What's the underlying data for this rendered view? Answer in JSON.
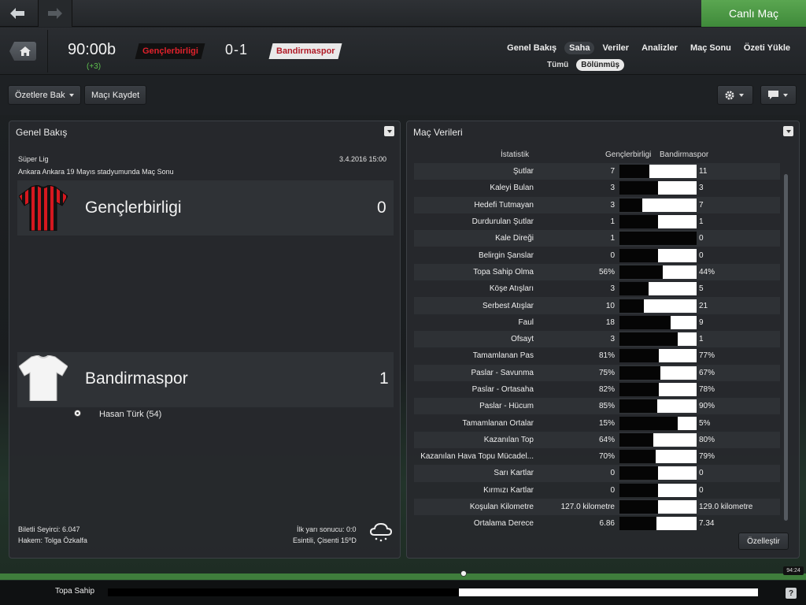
{
  "topbar": {
    "live_label": "Canlı Maç"
  },
  "match": {
    "clock": "90:00b",
    "added_time": "(+3)",
    "home_team": "Gençlerbirligi",
    "away_team": "Bandirmaspor",
    "score": "0-1"
  },
  "nav_tabs": [
    "Genel Bakış",
    "Saha",
    "Veriler",
    "Analizler",
    "Maç Sonu",
    "Özeti Yükle"
  ],
  "sub_tabs": [
    "Tümü",
    "Bölünmüş"
  ],
  "toolbar": {
    "highlights_label": "Özetlere Bak",
    "save_label": "Maçı Kaydet"
  },
  "overview": {
    "title": "Genel Bakış",
    "competition": "Süper Lig",
    "datetime": "3.4.2016 15:00",
    "venue": "Ankara Ankara 19 Mayıs stadyumunda Maç Sonu",
    "home": {
      "name": "Gençlerbirligi",
      "goals": "0"
    },
    "away": {
      "name": "Bandirmaspor",
      "goals": "1"
    },
    "scorer": "Hasan Türk (54)",
    "attendance": "Biletli Seyirci: 6.047",
    "referee": "Hakem: Tolga Özkalfa",
    "halftime": "İlk yarı sonucu: 0:0",
    "weather": "Esintili, Çisenti 15ºD"
  },
  "stats_panel": {
    "title": "Maç Verileri",
    "col_stat": "İstatistik",
    "col_home": "Gençlerbirligi",
    "col_away": "Bandirmaspor",
    "customize_label": "Özelleştir"
  },
  "chart_data": {
    "type": "bar",
    "series": [
      {
        "name": "Gençlerbirligi"
      },
      {
        "name": "Bandirmaspor"
      }
    ],
    "rows": [
      {
        "label": "Şutlar",
        "home": "7",
        "away": "11",
        "share": 0.39
      },
      {
        "label": "Kaleyi Bulan",
        "home": "3",
        "away": "3",
        "share": 0.5
      },
      {
        "label": "Hedefi Tutmayan",
        "home": "3",
        "away": "7",
        "share": 0.3
      },
      {
        "label": "Durdurulan Şutlar",
        "home": "1",
        "away": "1",
        "share": 0.5
      },
      {
        "label": "Kale Direği",
        "home": "1",
        "away": "0",
        "share": 1.0
      },
      {
        "label": "Belirgin Şanslar",
        "home": "0",
        "away": "0",
        "share": 0.5
      },
      {
        "label": "Topa Sahip Olma",
        "home": "56%",
        "away": "44%",
        "share": 0.56
      },
      {
        "label": "Köşe Atışları",
        "home": "3",
        "away": "5",
        "share": 0.375
      },
      {
        "label": "Serbest Atışlar",
        "home": "10",
        "away": "21",
        "share": 0.32
      },
      {
        "label": "Faul",
        "home": "18",
        "away": "9",
        "share": 0.667
      },
      {
        "label": "Ofsayt",
        "home": "3",
        "away": "1",
        "share": 0.75
      },
      {
        "label": "Tamamlanan Pas",
        "home": "81%",
        "away": "77%",
        "share": 0.51
      },
      {
        "label": "Paslar - Savunma",
        "home": "75%",
        "away": "67%",
        "share": 0.53
      },
      {
        "label": "Paslar - Ortasaha",
        "home": "82%",
        "away": "78%",
        "share": 0.51
      },
      {
        "label": "Paslar - Hücum",
        "home": "85%",
        "away": "90%",
        "share": 0.49
      },
      {
        "label": "Tamamlanan Ortalar",
        "home": "15%",
        "away": "5%",
        "share": 0.75
      },
      {
        "label": "Kazanılan Top",
        "home": "64%",
        "away": "80%",
        "share": 0.44
      },
      {
        "label": "Kazanılan Hava Topu Mücadel...",
        "home": "70%",
        "away": "79%",
        "share": 0.47
      },
      {
        "label": "Sarı Kartlar",
        "home": "0",
        "away": "0",
        "share": 0.5
      },
      {
        "label": "Kırmızı Kartlar",
        "home": "0",
        "away": "0",
        "share": 0.5
      },
      {
        "label": "Koşulan Kilometre",
        "home": "127.0 kilometre",
        "away": "129.0 kilometre",
        "share": 0.5
      },
      {
        "label": "Ortalama Derece",
        "home": "6.86",
        "away": "7.34",
        "share": 0.48
      }
    ]
  },
  "timeline": {
    "time": "94:24"
  },
  "possession": {
    "label": "Topa Sahip",
    "home_share": 0.54
  },
  "colors": {
    "live_green": "#4c9a45",
    "home_red": "#e0222c",
    "away_red": "#b01a26"
  }
}
